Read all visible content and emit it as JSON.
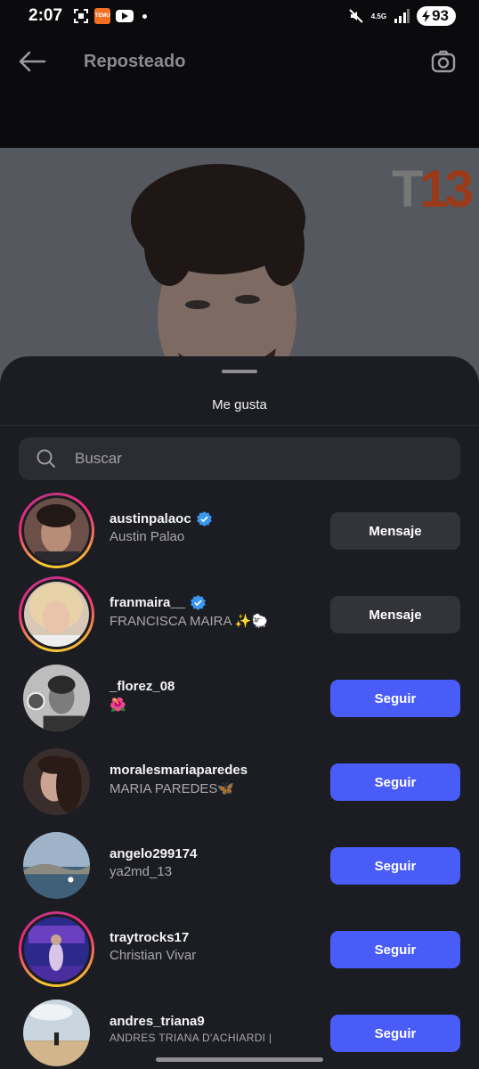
{
  "status_bar": {
    "time": "2:07",
    "temu_label": "TEMU",
    "network_label": "4.5G",
    "battery": "93"
  },
  "header": {
    "title": "Reposteado",
    "back_icon": "arrow-left-icon",
    "camera_icon": "camera-icon"
  },
  "media": {
    "logo_t": "T",
    "logo_13": "13"
  },
  "sheet": {
    "title": "Me gusta",
    "search_placeholder": "Buscar"
  },
  "users": [
    {
      "username": "austinpalaoc",
      "fullname": "Austin Palao",
      "verified": true,
      "button": "Mensaje",
      "story_ring": true
    },
    {
      "username": "franmaira__",
      "fullname": "FRANCISCA MAIRA ✨🐑",
      "verified": true,
      "button": "Mensaje",
      "story_ring": true
    },
    {
      "username": "_florez_08",
      "fullname": "🌺",
      "verified": false,
      "button": "Seguir",
      "story_ring": false
    },
    {
      "username": "moralesmariaparedes",
      "fullname": "MARIA PAREDES🦋",
      "verified": false,
      "button": "Seguir",
      "story_ring": false
    },
    {
      "username": "angelo299174",
      "fullname": "ya2md_13",
      "verified": false,
      "button": "Seguir",
      "story_ring": false
    },
    {
      "username": "traytrocks17",
      "fullname": "Christian Vivar",
      "verified": false,
      "button": "Seguir",
      "story_ring": true
    },
    {
      "username": "andres_triana9",
      "fullname": "ANDRES TRIANA D'ACHIARDI |",
      "verified": false,
      "button": "Seguir",
      "story_ring": false
    }
  ],
  "colors": {
    "follow_button": "#4a5cf7",
    "message_button": "#33343a",
    "sheet_background": "#1c1d22",
    "verified_badge": "#3897f0"
  }
}
